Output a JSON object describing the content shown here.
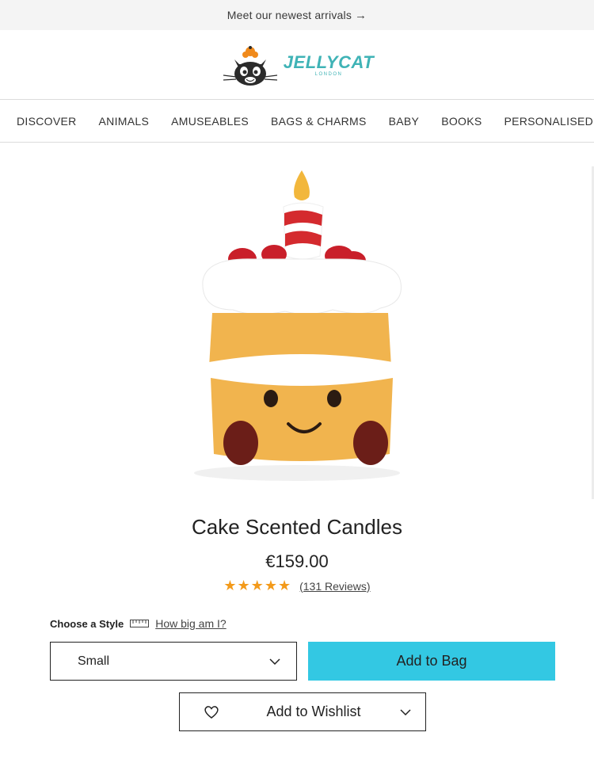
{
  "promo": {
    "text": "Meet our newest arrivals",
    "arrow": "→"
  },
  "brand": {
    "name": "JELLYCAT",
    "sub": "LONDON"
  },
  "nav": [
    "DISCOVER",
    "ANIMALS",
    "AMUSEABLES",
    "BAGS & CHARMS",
    "BABY",
    "BOOKS",
    "PERSONALISED"
  ],
  "product": {
    "title": "Cake Scented Candles",
    "price": "€159.00",
    "rating": 5,
    "stars": "★★★★★",
    "reviews": "(131 Reviews)"
  },
  "style": {
    "label": "Choose a Style",
    "howbig": "How big am I?",
    "selected": "Small"
  },
  "actions": {
    "add_to_bag": "Add to Bag",
    "wishlist": "Add to Wishlist"
  },
  "colors": {
    "accent": "#33c8e3",
    "star": "#f39a1a",
    "brand": "#3fb3b6"
  }
}
